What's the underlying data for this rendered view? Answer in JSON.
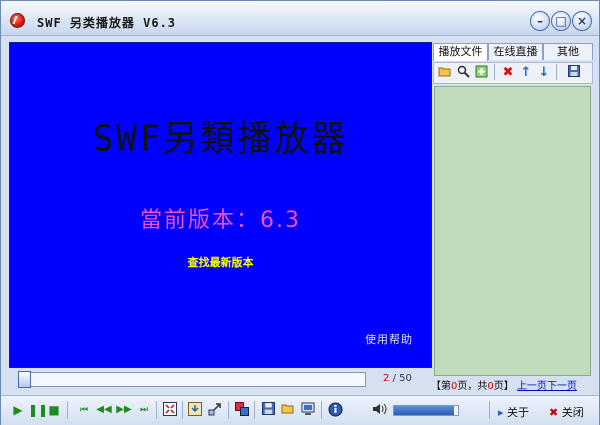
{
  "window": {
    "title": "SWF 另类播放器 V6.3",
    "buttons": {
      "minimize": "–",
      "maximize": "□",
      "close": "×"
    }
  },
  "stage": {
    "title": "SWF另類播放器",
    "version": "當前版本：6.3",
    "find_latest": "查找最新版本",
    "help": "使用帮助"
  },
  "progress": {
    "current": "2",
    "total": "/ 50",
    "position_fraction": 0
  },
  "panel": {
    "tabs": [
      "播放文件",
      "在线直播",
      "其他"
    ],
    "toolbar_icons": [
      "open-folder-icon",
      "search-icon",
      "add-icon",
      "delete-icon",
      "move-up-icon",
      "move-down-icon",
      "save-icon"
    ],
    "pager": {
      "prefix": "【第",
      "page": "0",
      "mid": "页，共",
      "pages": "0",
      "suffix": "页】",
      "prev": "上一页",
      "next": "下一页"
    }
  },
  "controls": {
    "icons": [
      "play-icon",
      "pause-icon",
      "stop-icon",
      "first-icon",
      "rewind-icon",
      "forward-icon",
      "last-icon",
      "fullscreen-icon",
      "capture-icon",
      "extract-icon",
      "copy-icon",
      "save-icon",
      "open-icon",
      "screenshot-icon",
      "info-icon",
      "volume-icon"
    ],
    "volume_level": 0.93,
    "about": "关于",
    "close": "关闭"
  },
  "colors": {
    "stage_bg": "#0000ff",
    "playlist_bg": "#c1dcbc",
    "version_text": "#f050c8",
    "link_text": "#ffff00"
  }
}
